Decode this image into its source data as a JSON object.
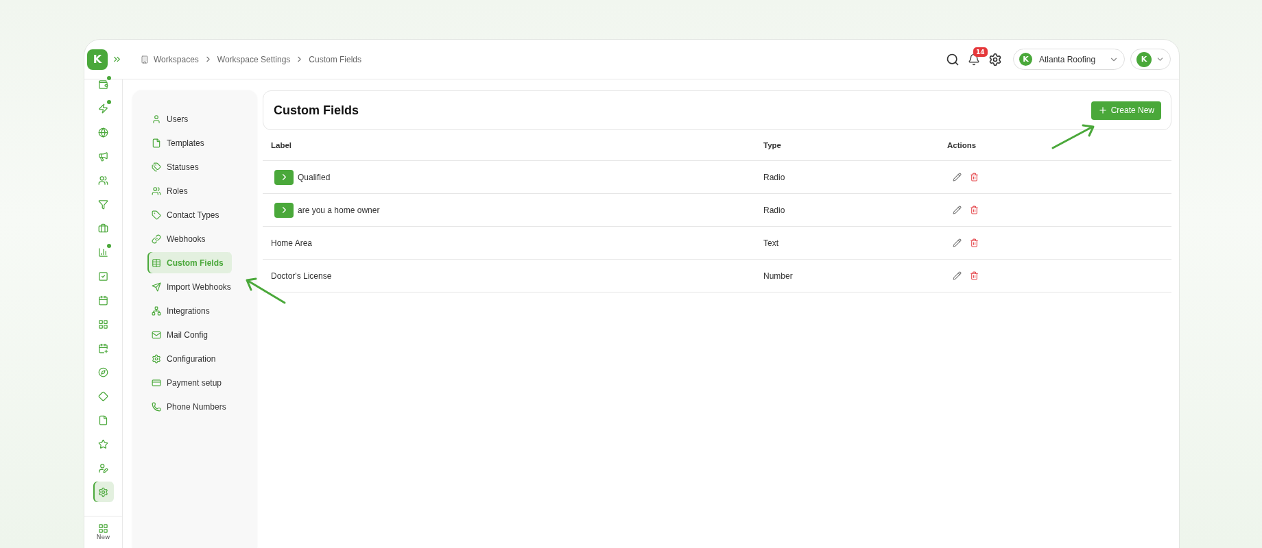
{
  "rail": {
    "items": [
      {
        "dot": true,
        "selected": false
      },
      {
        "dot": true,
        "selected": false
      },
      {
        "dot": false,
        "selected": false
      },
      {
        "dot": false,
        "selected": false
      },
      {
        "dot": false,
        "selected": false
      },
      {
        "dot": false,
        "selected": false
      },
      {
        "dot": false,
        "selected": false
      },
      {
        "dot": true,
        "selected": false
      },
      {
        "dot": false,
        "selected": false
      },
      {
        "dot": false,
        "selected": false
      },
      {
        "dot": false,
        "selected": false
      },
      {
        "dot": false,
        "selected": false
      },
      {
        "dot": false,
        "selected": false
      },
      {
        "dot": false,
        "selected": false
      },
      {
        "dot": false,
        "selected": false
      },
      {
        "dot": false,
        "selected": false
      },
      {
        "dot": false,
        "selected": false
      },
      {
        "dot": false,
        "selected": true
      }
    ],
    "new_label": "New"
  },
  "breadcrumb": [
    "Workspaces",
    "Workspace Settings",
    "Custom Fields"
  ],
  "logo": "K",
  "topbar": {
    "notifications": "14",
    "workspace_logo": "K",
    "workspace": "Atlanta Roofing",
    "avatar": "K"
  },
  "sidebar": {
    "items": [
      {
        "label": "Users",
        "selected": false
      },
      {
        "label": "Templates",
        "selected": false
      },
      {
        "label": "Statuses",
        "selected": false
      },
      {
        "label": "Roles",
        "selected": false
      },
      {
        "label": "Contact Types",
        "selected": false
      },
      {
        "label": "Webhooks",
        "selected": false
      },
      {
        "label": "Custom Fields",
        "selected": true
      },
      {
        "label": "Import Webhooks",
        "selected": false
      },
      {
        "label": "Integrations",
        "selected": false
      },
      {
        "label": "Mail Config",
        "selected": false
      },
      {
        "label": "Configuration",
        "selected": false
      },
      {
        "label": "Payment setup",
        "selected": false
      },
      {
        "label": "Phone Numbers",
        "selected": false
      }
    ]
  },
  "page": {
    "title": "Custom Fields",
    "create_button": "Create New"
  },
  "table": {
    "columns": [
      "Label",
      "Type",
      "Actions"
    ],
    "rows": [
      {
        "label": "Qualified",
        "type": "Radio",
        "expandable": true
      },
      {
        "label": "are you a home owner",
        "type": "Radio",
        "expandable": true
      },
      {
        "label": "Home Area",
        "type": "Text",
        "expandable": false
      },
      {
        "label": "Doctor's License",
        "type": "Number",
        "expandable": false
      }
    ]
  }
}
